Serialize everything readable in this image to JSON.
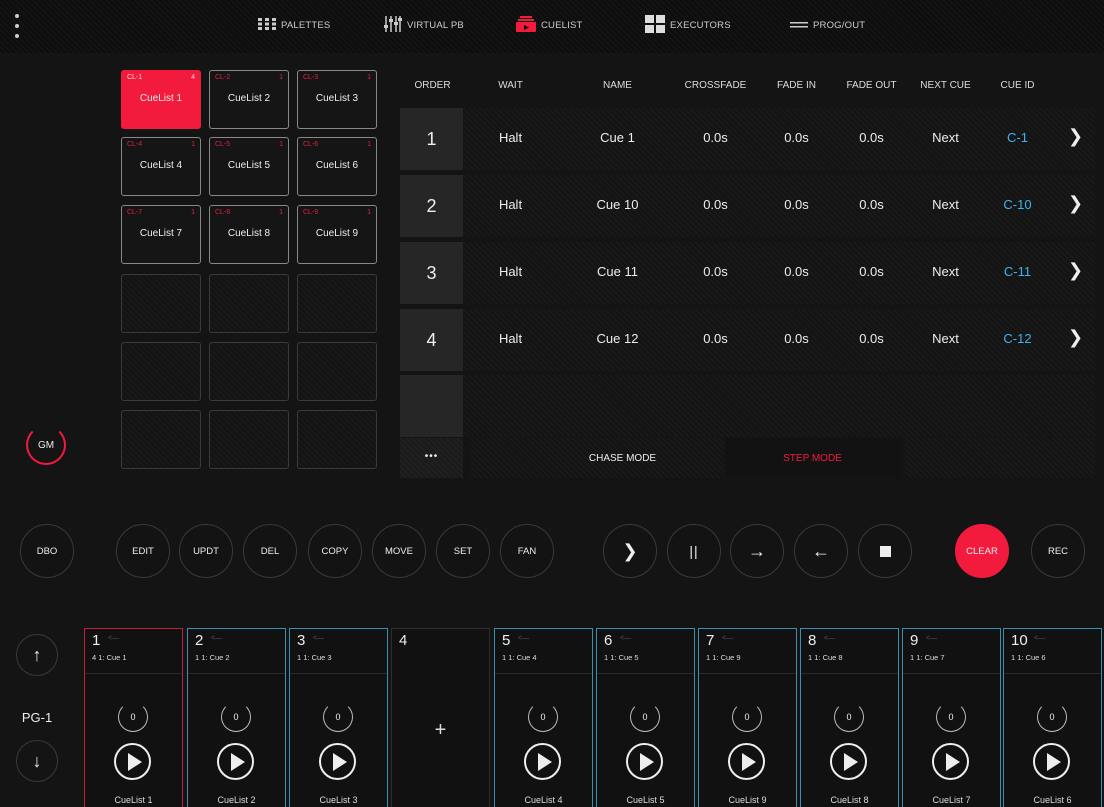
{
  "nav": {
    "tabs": [
      {
        "label": "PALETTES",
        "icon": "palettes-grid-icon"
      },
      {
        "label": "VIRTUAL PB",
        "icon": "faders-icon"
      },
      {
        "label": "CUELIST",
        "icon": "cuelist-icon"
      },
      {
        "label": "EXECUTORS",
        "icon": "executors-icon"
      },
      {
        "label": "PROG/OUT",
        "icon": "prog-out-icon"
      }
    ],
    "active_tab": "CUELIST",
    "accent": "#f31b3d"
  },
  "cuelists": [
    {
      "id": "CL-1",
      "count": "4",
      "name": "CueList 1"
    },
    {
      "id": "CL-2",
      "count": "1",
      "name": "CueList 2"
    },
    {
      "id": "CL-3",
      "count": "1",
      "name": "CueList 3"
    },
    {
      "id": "CL-4",
      "count": "1",
      "name": "CueList 4"
    },
    {
      "id": "CL-5",
      "count": "1",
      "name": "CueList 5"
    },
    {
      "id": "CL-6",
      "count": "1",
      "name": "CueList 6"
    },
    {
      "id": "CL-7",
      "count": "1",
      "name": "CueList 7"
    },
    {
      "id": "CL-8",
      "count": "1",
      "name": "CueList 8"
    },
    {
      "id": "CL-9",
      "count": "1",
      "name": "CueList 9"
    }
  ],
  "gm_label": "GM",
  "table": {
    "headers": [
      "ORDER",
      "WAIT",
      "NAME",
      "CROSSFADE",
      "FADE IN",
      "FADE OUT",
      "NEXT CUE",
      "CUE ID"
    ],
    "rows": [
      {
        "order": "1",
        "wait": "Halt",
        "name": "Cue 1",
        "crossfade": "0.0s",
        "fade_in": "0.0s",
        "fade_out": "0.0s",
        "next": "Next",
        "cue_id": "C-1"
      },
      {
        "order": "2",
        "wait": "Halt",
        "name": "Cue 10",
        "crossfade": "0.0s",
        "fade_in": "0.0s",
        "fade_out": "0.0s",
        "next": "Next",
        "cue_id": "C-10"
      },
      {
        "order": "3",
        "wait": "Halt",
        "name": "Cue 11",
        "crossfade": "0.0s",
        "fade_in": "0.0s",
        "fade_out": "0.0s",
        "next": "Next",
        "cue_id": "C-11"
      },
      {
        "order": "4",
        "wait": "Halt",
        "name": "Cue 12",
        "crossfade": "0.0s",
        "fade_in": "0.0s",
        "fade_out": "0.0s",
        "next": "Next",
        "cue_id": "C-12"
      }
    ],
    "cue_id_color": "#3db4f0"
  },
  "modes": {
    "more": "•••",
    "chase": "CHASE MODE",
    "step": "STEP MODE"
  },
  "buttons": {
    "dbo": "DBO",
    "edit": "EDIT",
    "updt": "UPDT",
    "del": "DEL",
    "copy": "COPY",
    "move": "MOVE",
    "set": "SET",
    "fan": "FAN",
    "clear": "CLEAR",
    "rec": "REC"
  },
  "page": {
    "label": "PG-1"
  },
  "executors": [
    {
      "num": "1",
      "sub": "4   1: Cue 1",
      "label": "CueList 1",
      "level": "0"
    },
    {
      "num": "2",
      "sub": "1   1: Cue 2",
      "label": "CueList 2",
      "level": "0"
    },
    {
      "num": "3",
      "sub": "1   1: Cue 3",
      "label": "CueList 3",
      "level": "0"
    },
    {
      "num": "4",
      "sub": "",
      "label": "",
      "level": ""
    },
    {
      "num": "5",
      "sub": "1   1: Cue 4",
      "label": "CueList 4",
      "level": "0"
    },
    {
      "num": "6",
      "sub": "1   1: Cue 5",
      "label": "CueList 5",
      "level": "0"
    },
    {
      "num": "7",
      "sub": "1   1: Cue 9",
      "label": "CueList 9",
      "level": "0"
    },
    {
      "num": "8",
      "sub": "1   1: Cue 8",
      "label": "CueList 8",
      "level": "0"
    },
    {
      "num": "9",
      "sub": "1   1: Cue 7",
      "label": "CueList 7",
      "level": "0"
    },
    {
      "num": "10",
      "sub": "1   1: Cue 6",
      "label": "CueList 6",
      "level": "0"
    }
  ]
}
